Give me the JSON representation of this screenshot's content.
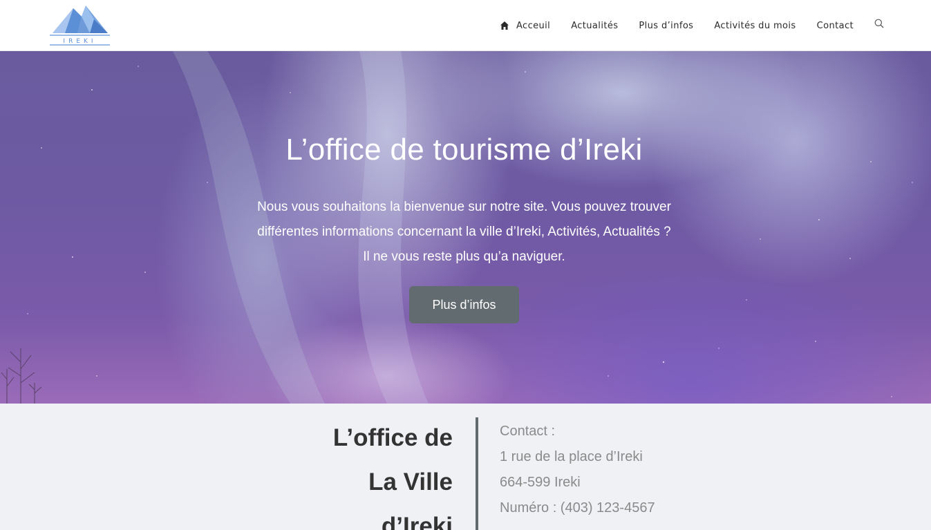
{
  "header": {
    "logo_text": "IREKI",
    "nav": [
      {
        "label": "Acceuil",
        "icon": "home-icon"
      },
      {
        "label": "Actualités"
      },
      {
        "label": "Plus d’infos"
      },
      {
        "label": "Activités du mois"
      },
      {
        "label": "Contact"
      }
    ],
    "search_icon": "search-icon"
  },
  "hero": {
    "title": "L’office de tourisme d’Ireki",
    "text_lines": [
      "Nous vous souhaitons la bienvenue sur notre site. Vous pouvez trouver",
      "différentes informations concernant la ville d’Ireki, Activités, Actualités ?",
      "Il ne vous reste plus qu’a naviguer."
    ],
    "button_label": "Plus d’infos"
  },
  "info": {
    "title_lines": [
      "L’office de",
      "La Ville",
      "d’Ireki"
    ],
    "contact_lines": [
      "Contact :",
      "1 rue de la place d’Ireki",
      "664-599 Ireki",
      "Numéro : (403) 123-4567"
    ]
  },
  "colors": {
    "button": "#626b6f",
    "divider": "#626b6f",
    "info_bg": "#f0f1f5",
    "logo_blue": "#5b8fd6"
  }
}
